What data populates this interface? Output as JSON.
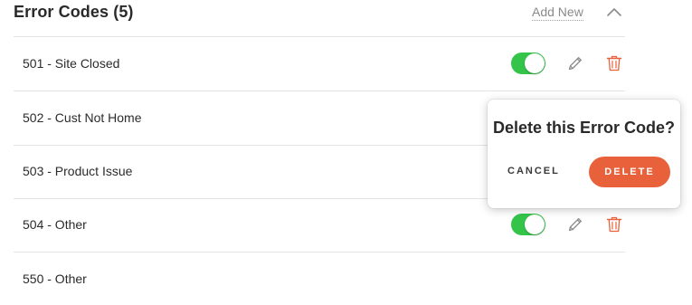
{
  "header": {
    "title": "Error Codes (5)",
    "add_new_label": "Add New",
    "collapse_icon": "chevron-up-icon"
  },
  "rows": [
    {
      "label": "501 - Site Closed",
      "enabled": true,
      "show_actions": true
    },
    {
      "label": "502 - Cust Not Home",
      "show_actions": false
    },
    {
      "label": "503 - Product Issue",
      "show_actions": false
    },
    {
      "label": "504 - Other",
      "enabled": true,
      "show_actions": true
    },
    {
      "label": "550 - Other",
      "show_actions": false
    }
  ],
  "popover": {
    "title": "Delete this Error Code?",
    "cancel_label": "CANCEL",
    "delete_label": "DELETE"
  },
  "colors": {
    "toggle_on": "#34c44a",
    "delete_accent": "#e8613a",
    "trash_icon": "#e8613a",
    "muted_text": "#8a8a8a"
  },
  "icons": {
    "edit": "pencil-icon",
    "delete": "trash-icon"
  }
}
